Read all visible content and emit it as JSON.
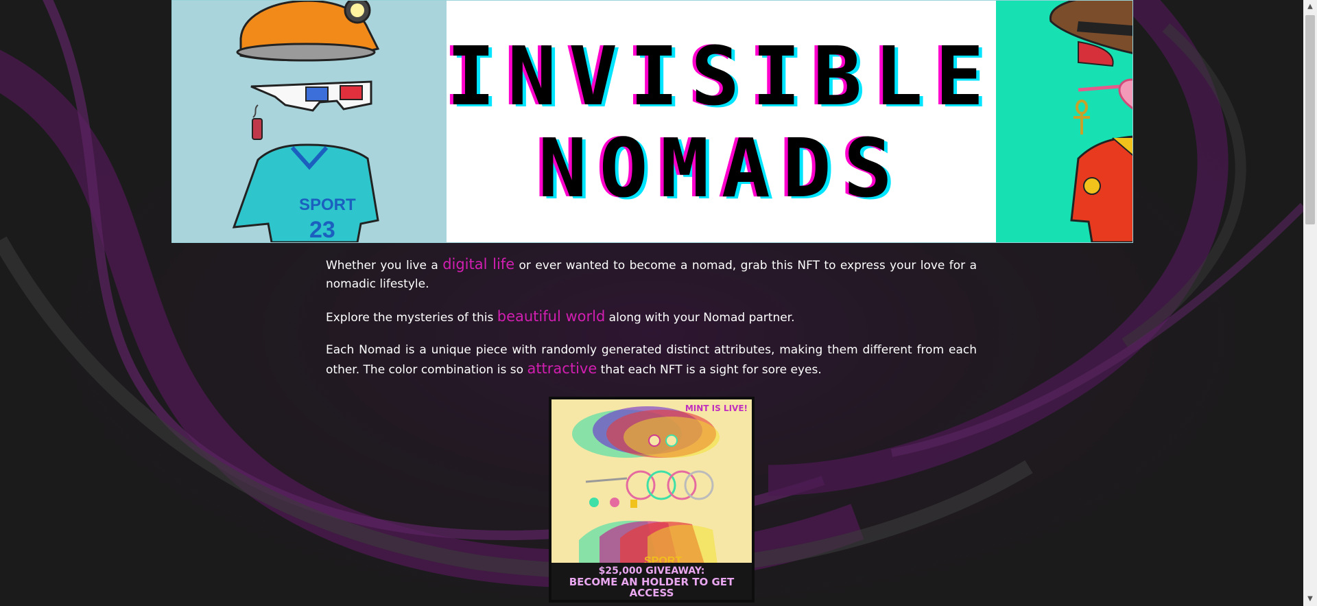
{
  "banner": {
    "title_line1": "INVISIBLE",
    "title_line2": "NOMADS",
    "left_panel_color": "#a9d4dc",
    "right_panel_color": "#17e1b3",
    "jersey_text_line1": "SPORT",
    "jersey_text_line2": "23",
    "items": {
      "left": [
        "miner-helmet-icon",
        "3d-glasses-icon",
        "dynamite-icon",
        "sport-jersey-icon"
      ],
      "right": [
        "cowboy-hat-icon",
        "heart-sunglasses-icon",
        "ankh-pendant-icon",
        "polo-shirt-icon"
      ]
    }
  },
  "content": {
    "p1_before": "Whether you live a ",
    "p1_highlight": "digital life",
    "p1_after": " or ever wanted to become a nomad, grab this NFT to express your love for a nomadic lifestyle.",
    "p2_before": "Explore the mysteries of this ",
    "p2_highlight": "beautiful world",
    "p2_after": " along with your Nomad partner.",
    "p3_before": "Each Nomad is a unique piece with randomly generated distinct attributes, making them different from each other. The color combination is so ",
    "p3_highlight": "attractive",
    "p3_after": " that each NFT is a sight for sore eyes."
  },
  "promo": {
    "mint_badge": "MINT IS LIVE!",
    "jersey_text": "SPORT",
    "giveaway_line1": "$25,000 GIVEAWAY:",
    "giveaway_line2": "BECOME AN HOLDER TO GET ACCESS"
  },
  "colors": {
    "accent": "#d21fb1",
    "background": "#1b1b1b",
    "text": "#ffffff"
  }
}
